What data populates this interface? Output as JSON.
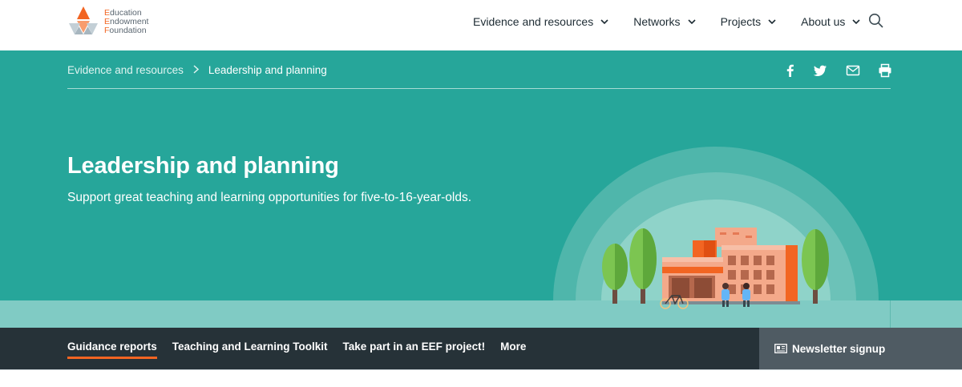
{
  "logo": {
    "name": "Education Endowment Foundation",
    "lines": [
      {
        "cap": "E",
        "rest": "ducation"
      },
      {
        "cap": "E",
        "rest": "ndowment"
      },
      {
        "cap": "F",
        "rest": "oundation"
      }
    ],
    "colors": {
      "orange": "#f26522",
      "grey": "#a7b6bf"
    }
  },
  "nav": {
    "items": [
      {
        "label": "Evidence and resources",
        "icon": "chevron-down-icon"
      },
      {
        "label": "Networks",
        "icon": "chevron-down-icon"
      },
      {
        "label": "Projects",
        "icon": "chevron-down-icon"
      },
      {
        "label": "About us",
        "icon": "chevron-down-icon"
      }
    ],
    "search_icon": "search-icon"
  },
  "breadcrumb": {
    "items": [
      "Evidence and resources",
      "Leadership and planning"
    ],
    "separator": ">"
  },
  "share": {
    "icons": [
      "facebook-icon",
      "twitter-icon",
      "email-icon",
      "print-icon"
    ]
  },
  "hero": {
    "title": "Leadership and planning",
    "subtitle": "Support great teaching and learning opportunities for five-to-16-year-olds.",
    "background": "#26a69a",
    "illustration": "school-building-illustration"
  },
  "subnav": {
    "links": [
      {
        "label": "Guidance reports",
        "active": true
      },
      {
        "label": "Teaching and Learning Toolkit",
        "active": false
      },
      {
        "label": "Take part in an EEF project!",
        "active": false
      },
      {
        "label": "More",
        "active": false
      }
    ],
    "newsletter": {
      "label": "Newsletter signup",
      "icon": "newspaper-icon"
    },
    "accent": "#f26522",
    "background": "#263238"
  }
}
